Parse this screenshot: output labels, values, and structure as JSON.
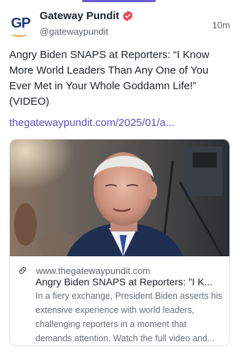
{
  "author": {
    "avatar_text": "GP",
    "name": "Gateway Pundit",
    "handle": "@gatewaypundit",
    "verified_icon": "verified-badge-icon",
    "brand_color": "#1e3a78",
    "verified_color": "#e8455f"
  },
  "post": {
    "time": "10m",
    "text": "Angry Biden SNAPS at Reporters: “I Know More World Leaders Than Any One of You Ever Met in Your Whole Goddamn Life!” (VIDEO)",
    "link_text": "thegatewaypundit.com/2025/01/a...",
    "link_color": "#5a4fcf"
  },
  "card": {
    "domain": "www.thegatewaypundit.com",
    "title": "Angry Biden SNAPS at Reporters: \"I K...",
    "description": "In a fiery exchange, President Biden asserts his extensive experience with world leaders, challenging reporters in a moment that demands attention. Watch the full video and...",
    "link_icon": "link-icon"
  }
}
